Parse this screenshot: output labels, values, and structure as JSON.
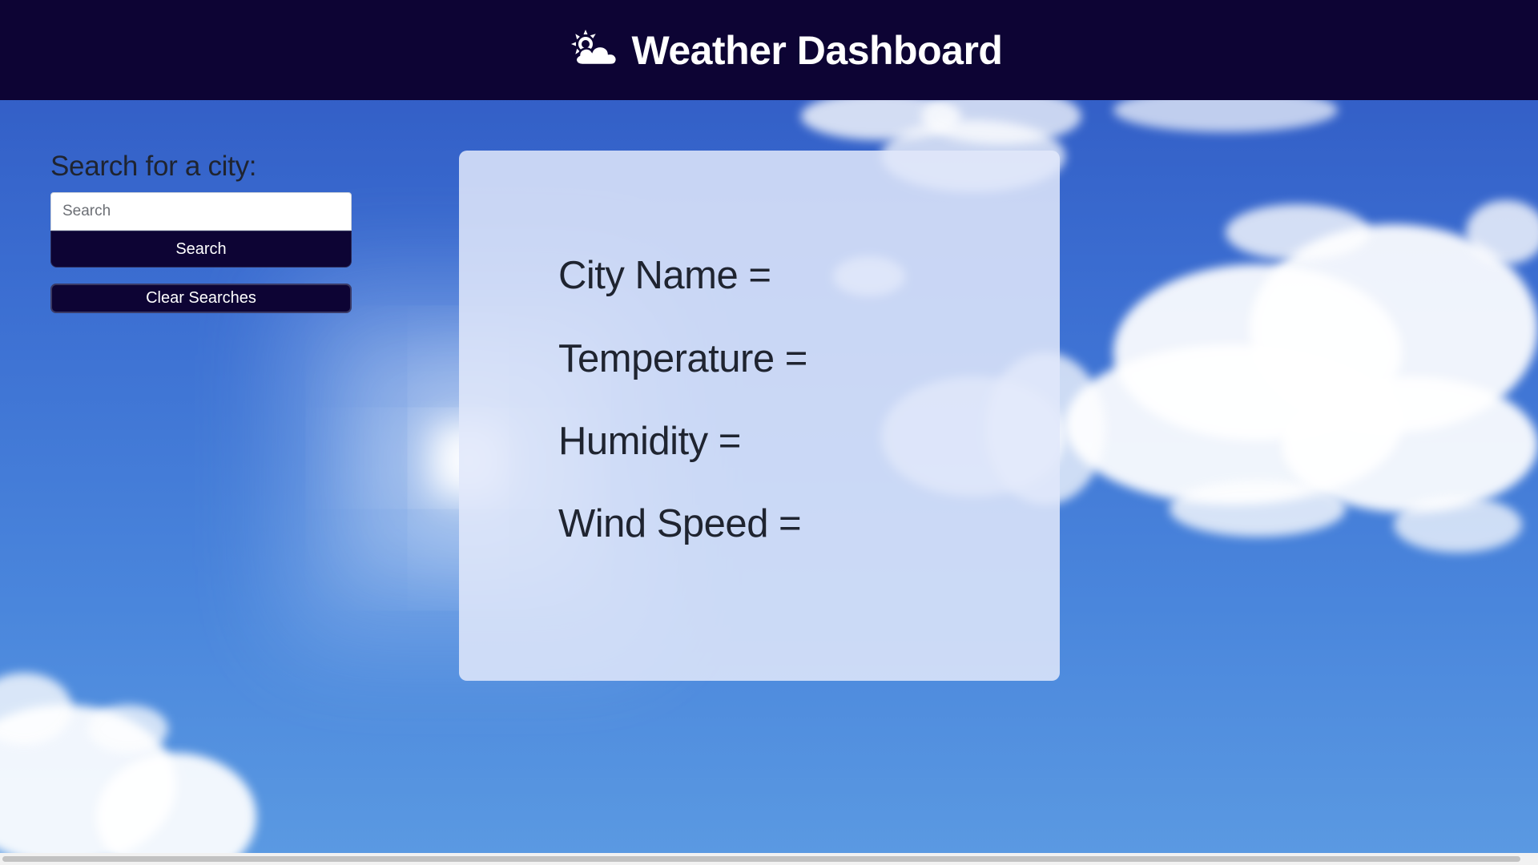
{
  "header": {
    "title": "Weather Dashboard",
    "icon": "sun-behind-cloud-icon"
  },
  "sidebar": {
    "search_label": "Search for a city:",
    "search_placeholder": "Search",
    "search_value": "",
    "search_button": "Search",
    "clear_button": "Clear Searches"
  },
  "weather": {
    "city_name": "City Name =",
    "temperature": "Temperature =",
    "humidity": "Humidity =",
    "wind_speed": "Wind Speed ="
  },
  "colors": {
    "header_bg": "#0d0434",
    "button_bg": "#0d0434",
    "card_bg": "#e1e8fa",
    "sky": "#3c6fd2"
  }
}
